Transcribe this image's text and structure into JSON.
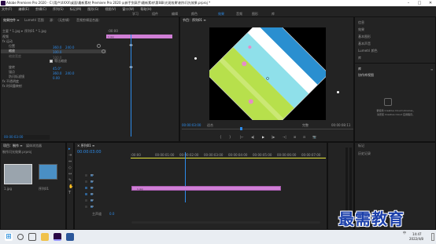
{
  "titlebar": {
    "title": "Adobe Premiere Pro 2020 - C:\\用户\\XXXX\\桌面\\最新素材 Premiere Pro 2020 从新手到高手\\最新素材\\第8章\\光斑效果\\制作闪光效果.prproj *",
    "minimize": "–",
    "maximize": "□",
    "close": "✕"
  },
  "menu": [
    "文件(F)",
    "编辑(E)",
    "剪辑(C)",
    "序列(S)",
    "标记(M)",
    "图形(G)",
    "视图(V)",
    "窗口(W)",
    "帮助(H)"
  ],
  "workspaces": [
    {
      "label": "学习",
      "active": false
    },
    {
      "label": "组件",
      "active": false
    },
    {
      "label": "编辑",
      "active": false
    },
    {
      "label": "颜色",
      "active": false
    },
    {
      "label": "效果",
      "active": true
    },
    {
      "label": "音频",
      "active": false
    },
    {
      "label": "图形",
      "active": false
    },
    {
      "label": "库",
      "active": false
    }
  ],
  "effect_controls": {
    "tabs": [
      "效果控件 ≡",
      "Lumetri 范围",
      "源：（无剪辑）",
      "音频剪辑混合器："
    ],
    "source_label": "主要 * 1.jpg ▾",
    "clip_label": "序列01 * 1.jpg",
    "time_start": ":00:00",
    "clip_name": "1.jpg",
    "sections": [
      "视频",
      "fx 运动",
      "位置",
      "缩放",
      "缩放宽度",
      "等比缩放",
      "旋转",
      "锚点",
      "防闪烁滤镜",
      "fx 不透明度",
      "fx 时间重映射"
    ],
    "values": {
      "position_x": "360.0",
      "position_y": "240.0",
      "scale": "100.0",
      "scale_width": "100.0",
      "rotation": "45.0°",
      "anchor_x": "360.0",
      "anchor_y": "240.0",
      "anti_flicker": "0.00"
    },
    "timecode": "00:00:03:00"
  },
  "program": {
    "tab": "节目：序列01 ≡",
    "timecode": "00:00:03:00",
    "fit": "适合",
    "quality": "完整",
    "duration": "00:00:08:11",
    "controls": [
      "{",
      "}",
      "|←",
      "◀|",
      "▶",
      "|▶",
      "→|",
      "⊞",
      "⊟",
      "📷"
    ]
  },
  "right_panel": {
    "items": [
      "信息",
      "效果",
      "基本图形",
      "基本声音",
      "Lumetri 颜色",
      "库"
    ],
    "lib_title": "库",
    "lib_tab": "协作库视图",
    "cloud_msg1": "要使用 Creative Cloud Libraries，",
    "cloud_msg2": "请安装 Creative Cloud 应用程序。",
    "bottom_items": [
      "标记",
      "历史记录"
    ]
  },
  "project": {
    "tabs": [
      "项目：制作 ≡",
      "媒体浏览器"
    ],
    "file": "制作闪光效果.prproj",
    "thumbs": [
      "1.jpg",
      "序列01"
    ]
  },
  "timeline": {
    "tab": "× 序列01 ≡",
    "timecode": "00:00:03:00",
    "ruler": [
      ":00:00",
      "00:00:01:00",
      "00:00:02:00",
      "00:00:03:00",
      "00:00:04:00",
      "00:00:05:00",
      "00:00:06:00",
      "00:00:07:00",
      "00:00:08:00"
    ],
    "tracks": [
      "V3",
      "V2",
      "V1",
      "A1",
      "A2",
      "A3"
    ],
    "master": "主声道",
    "master_val": "0.0",
    "clip": "1.jpg"
  },
  "taskbar": {
    "time": "14:47",
    "date": "2022/4/8",
    "lang": "中"
  },
  "watermark": "最需教育"
}
